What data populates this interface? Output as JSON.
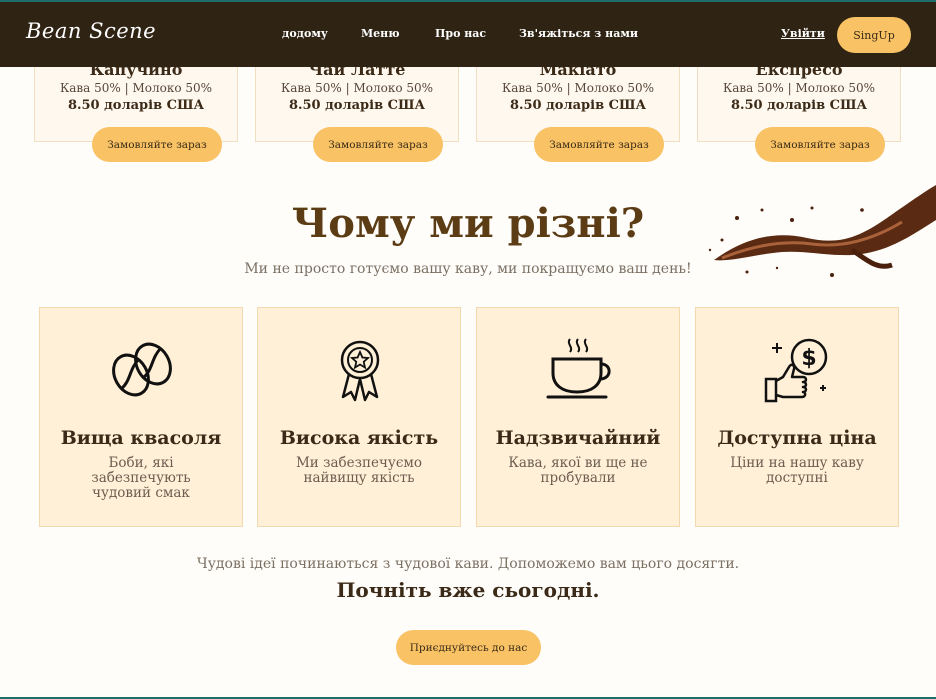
{
  "brand": {
    "logo": "Bean Scene"
  },
  "nav": {
    "links": [
      "додому",
      "Меню",
      "Про нас",
      "Зв'яжіться з нами"
    ],
    "login": "Увійти",
    "signup": "SingUp"
  },
  "products": [
    {
      "name": "Капучино",
      "desc": "Кава 50% | Молоко 50%",
      "price": "8.50 доларів США",
      "order": "Замовляйте зараз"
    },
    {
      "name": "Чай Латте",
      "desc": "Кава 50% | Молоко 50%",
      "price": "8.50 доларів США",
      "order": "Замовляйте зараз"
    },
    {
      "name": "Макіато",
      "desc": "Кава 50% | Молоко 50%",
      "price": "8.50 доларів США",
      "order": "Замовляйте зараз"
    },
    {
      "name": "Експресо",
      "desc": "Кава 50% | Молоко 50%",
      "price": "8.50 доларів США",
      "order": "Замовляйте зараз"
    }
  ],
  "why": {
    "title": "Чому ми різні?",
    "subtitle": "Ми не просто готуємо вашу каву, ми покращуємо ваш день!"
  },
  "features": [
    {
      "icon": "coffee-beans-icon",
      "title": "Вища квасоля",
      "desc": "Боби, які забезпечують чудовий смак"
    },
    {
      "icon": "award-badge-icon",
      "title": "Висока якість",
      "desc": "Ми забезпечуємо найвищу якість"
    },
    {
      "icon": "coffee-cup-icon",
      "title": "Надзвичайний",
      "desc": "Кава, якої ви ще не пробували"
    },
    {
      "icon": "thumbs-up-dollar-icon",
      "title": "Доступна ціна",
      "desc": "Ціни на нашу каву доступні"
    }
  ],
  "cta": {
    "tagline": "Чудові ідеї починаються з чудової кави. Допоможемо вам цього досягти.",
    "title": "Почніть вже сьогодні.",
    "button": "Приєднуйтесь до нас"
  },
  "colors": {
    "navbar": "#2f2314",
    "accent": "#f8c265",
    "heading": "#5b3c15",
    "card": "#fff0d7"
  }
}
